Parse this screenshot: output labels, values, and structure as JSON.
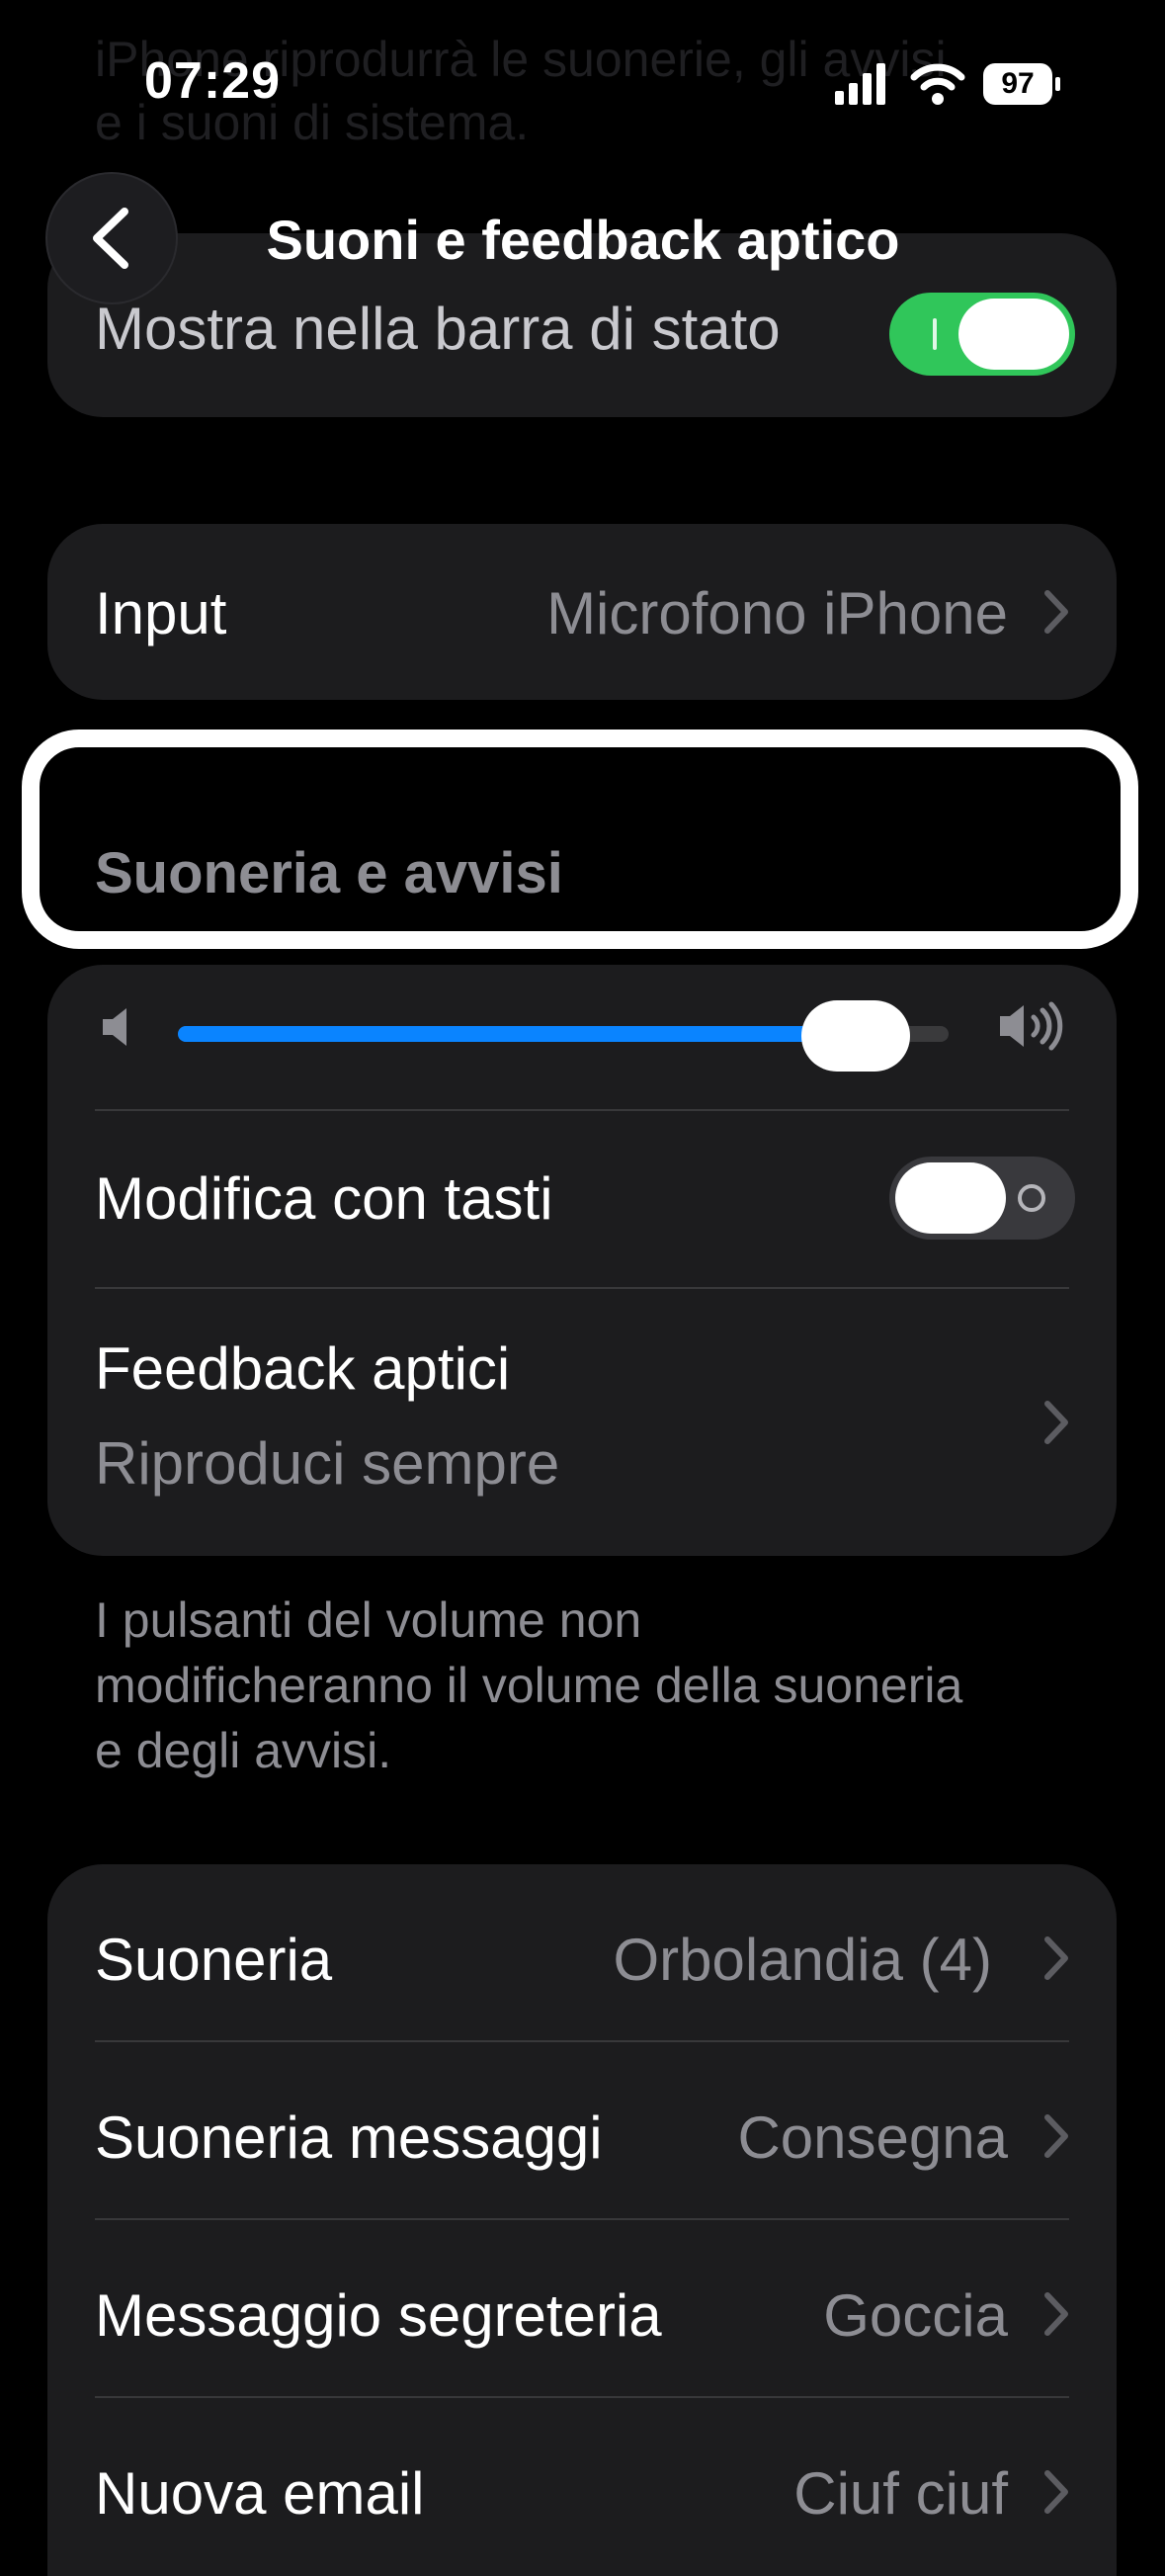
{
  "background_text": "iPhone riprodurrà le suonerie, gli avvisi\ne i suoni di sistema.",
  "status_bar": {
    "time": "07:29",
    "battery": "97"
  },
  "nav": {
    "title": "Suoni e feedback aptico",
    "back_icon": "chevron-left-icon"
  },
  "top_card": {
    "status_bar_row": {
      "label": "Mostra nella barra di stato",
      "toggle_on": true
    }
  },
  "input_card": {
    "label": "Input",
    "value": "Microfono iPhone"
  },
  "ringer_section": {
    "header": "Suoneria e avvisi",
    "volume_fraction": 0.88,
    "change_with_buttons": {
      "label": "Modifica con tasti",
      "toggle_on": false
    },
    "haptics": {
      "label": "Feedback aptici",
      "subtitle": "Riproduci sempre"
    },
    "footnote": "I pulsanti del volume non modificheranno il volume della suoneria e degli avvisi."
  },
  "sounds_card": {
    "items": [
      {
        "label": "Suoneria",
        "value": "Orbolandia (4)"
      },
      {
        "label": "Suoneria messaggi",
        "value": "Consegna"
      },
      {
        "label": "Messaggio segreteria",
        "value": "Goccia"
      },
      {
        "label": "Nuova email",
        "value": "Ciuf ciuf"
      }
    ]
  },
  "colors": {
    "accent": "#0a84ff",
    "toggle_on": "#30c65a",
    "card": "#1c1c1e",
    "secondary_text": "#8d8d93"
  }
}
